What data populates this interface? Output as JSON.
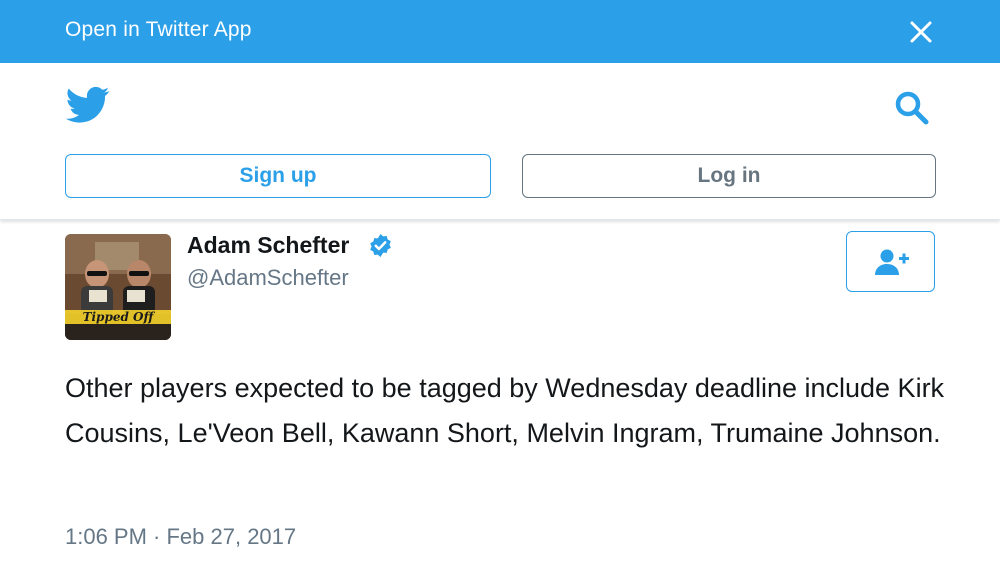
{
  "banner": {
    "text": "Open in Twitter App",
    "close_icon": "close-icon",
    "color": "#2b9fe8"
  },
  "header": {
    "logo_icon": "twitter-bird-icon",
    "search_icon": "search-icon",
    "signup_label": "Sign up",
    "login_label": "Log in"
  },
  "tweet": {
    "author_name": "Adam Schefter",
    "verified_icon": "verified-badge-icon",
    "handle": "@AdamSchefter",
    "follow_icon": "follow-user-icon",
    "avatar_caption": "Tipped Off",
    "text": "Other players expected to be tagged by Wednesday deadline include Kirk Cousins, Le'Veon Bell, Kawann Short, Melvin Ingram, Trumaine Johnson.",
    "timestamp": "1:06 PM · Feb 27, 2017"
  },
  "colors": {
    "accent": "#2b9fe8",
    "text_primary": "#14171a",
    "text_secondary": "#657786"
  }
}
